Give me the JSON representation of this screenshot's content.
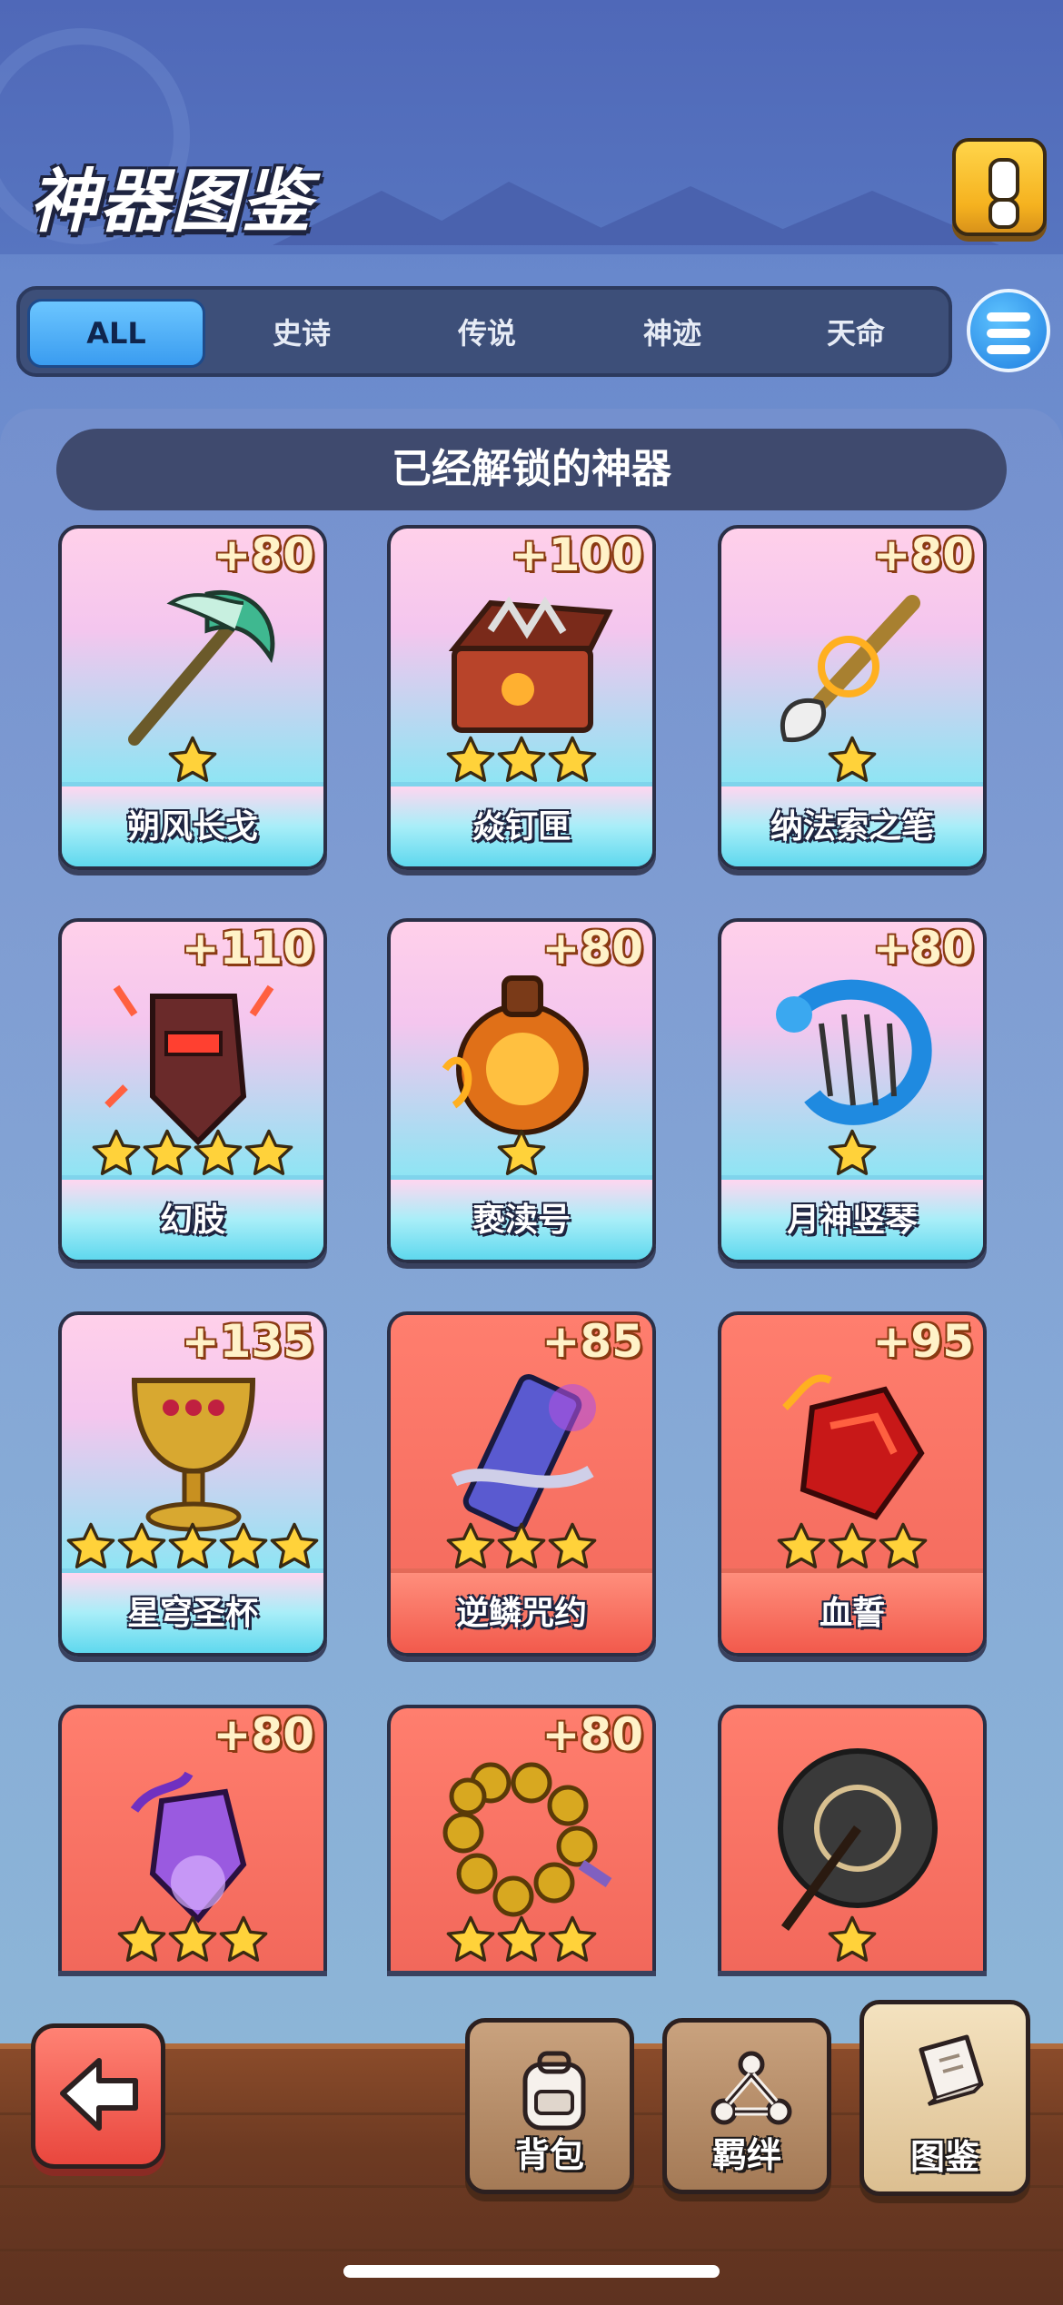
{
  "header": {
    "title": "神器图鉴",
    "help_icon": "exclamation-icon"
  },
  "tabs": [
    {
      "label": "ALL",
      "active": true
    },
    {
      "label": "史诗",
      "active": false
    },
    {
      "label": "传说",
      "active": false
    },
    {
      "label": "神迹",
      "active": false
    },
    {
      "label": "天命",
      "active": false
    }
  ],
  "filter_icon": "list-icon",
  "section_title": "已经解锁的神器",
  "artifacts": [
    {
      "name": "朔风长戈",
      "bonus": "+80",
      "stars": 1,
      "rarity": "blue",
      "icon": "halberd-icon"
    },
    {
      "name": "焱钉匣",
      "bonus": "+100",
      "stars": 3,
      "rarity": "blue",
      "icon": "box-icon"
    },
    {
      "name": "纳法索之笔",
      "bonus": "+80",
      "stars": 1,
      "rarity": "blue",
      "icon": "brush-icon"
    },
    {
      "name": "幻肢",
      "bonus": "+110",
      "stars": 4,
      "rarity": "blue",
      "icon": "gauntlet-icon"
    },
    {
      "name": "亵渎号",
      "bonus": "+80",
      "stars": 1,
      "rarity": "blue",
      "icon": "lantern-icon"
    },
    {
      "name": "月神竖琴",
      "bonus": "+80",
      "stars": 1,
      "rarity": "blue",
      "icon": "harp-icon"
    },
    {
      "name": "星穹圣杯",
      "bonus": "+135",
      "stars": 5,
      "rarity": "blue",
      "icon": "chalice-icon"
    },
    {
      "name": "逆鳞咒约",
      "bonus": "+85",
      "stars": 3,
      "rarity": "red",
      "icon": "scroll-icon"
    },
    {
      "name": "血誓",
      "bonus": "+95",
      "stars": 3,
      "rarity": "red",
      "icon": "blood-gem-icon"
    },
    {
      "name": "",
      "bonus": "+80",
      "stars": 3,
      "rarity": "red",
      "icon": "purple-crystal-icon"
    },
    {
      "name": "",
      "bonus": "+80",
      "stars": 3,
      "rarity": "red",
      "icon": "beads-icon"
    },
    {
      "name": "",
      "bonus": "",
      "stars": 1,
      "rarity": "red",
      "icon": "umbrella-icon"
    }
  ],
  "bottom_nav": {
    "back_icon": "arrow-left-icon",
    "items": [
      {
        "label": "背包",
        "icon": "backpack-icon",
        "active": false
      },
      {
        "label": "羁绊",
        "icon": "bond-icon",
        "active": false
      },
      {
        "label": "图鉴",
        "icon": "book-icon",
        "active": true
      }
    ]
  },
  "colors": {
    "accent": "#3a9cf0",
    "panel": "#3f4a6e",
    "star": "#ffd23a",
    "red_card": "#f2685b"
  }
}
